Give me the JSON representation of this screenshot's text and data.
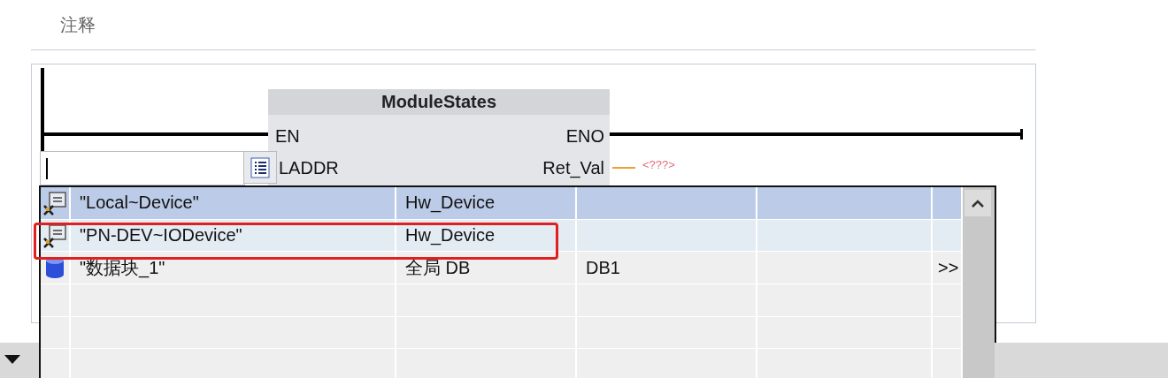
{
  "comment_label": "注释",
  "block": {
    "title": "ModuleStates",
    "inputs": [
      "EN",
      "LADDR"
    ],
    "outputs": [
      "ENO",
      "Ret_Val"
    ],
    "ret_val_placeholder": "<???>"
  },
  "suggestions": [
    {
      "kind": "device",
      "name": "\"Local~Device\"",
      "type": "Hw_Device",
      "selected": true,
      "hovered": false,
      "highlighted": false
    },
    {
      "kind": "device",
      "name": "\"PN-DEV~IODevice\"",
      "type": "Hw_Device",
      "selected": false,
      "hovered": true,
      "highlighted": true
    },
    {
      "kind": "db",
      "name": "\"数据块_1\"",
      "type": "全局 DB",
      "column_3": "DB1",
      "more": ">>",
      "selected": false,
      "hovered": false,
      "highlighted": false
    }
  ]
}
